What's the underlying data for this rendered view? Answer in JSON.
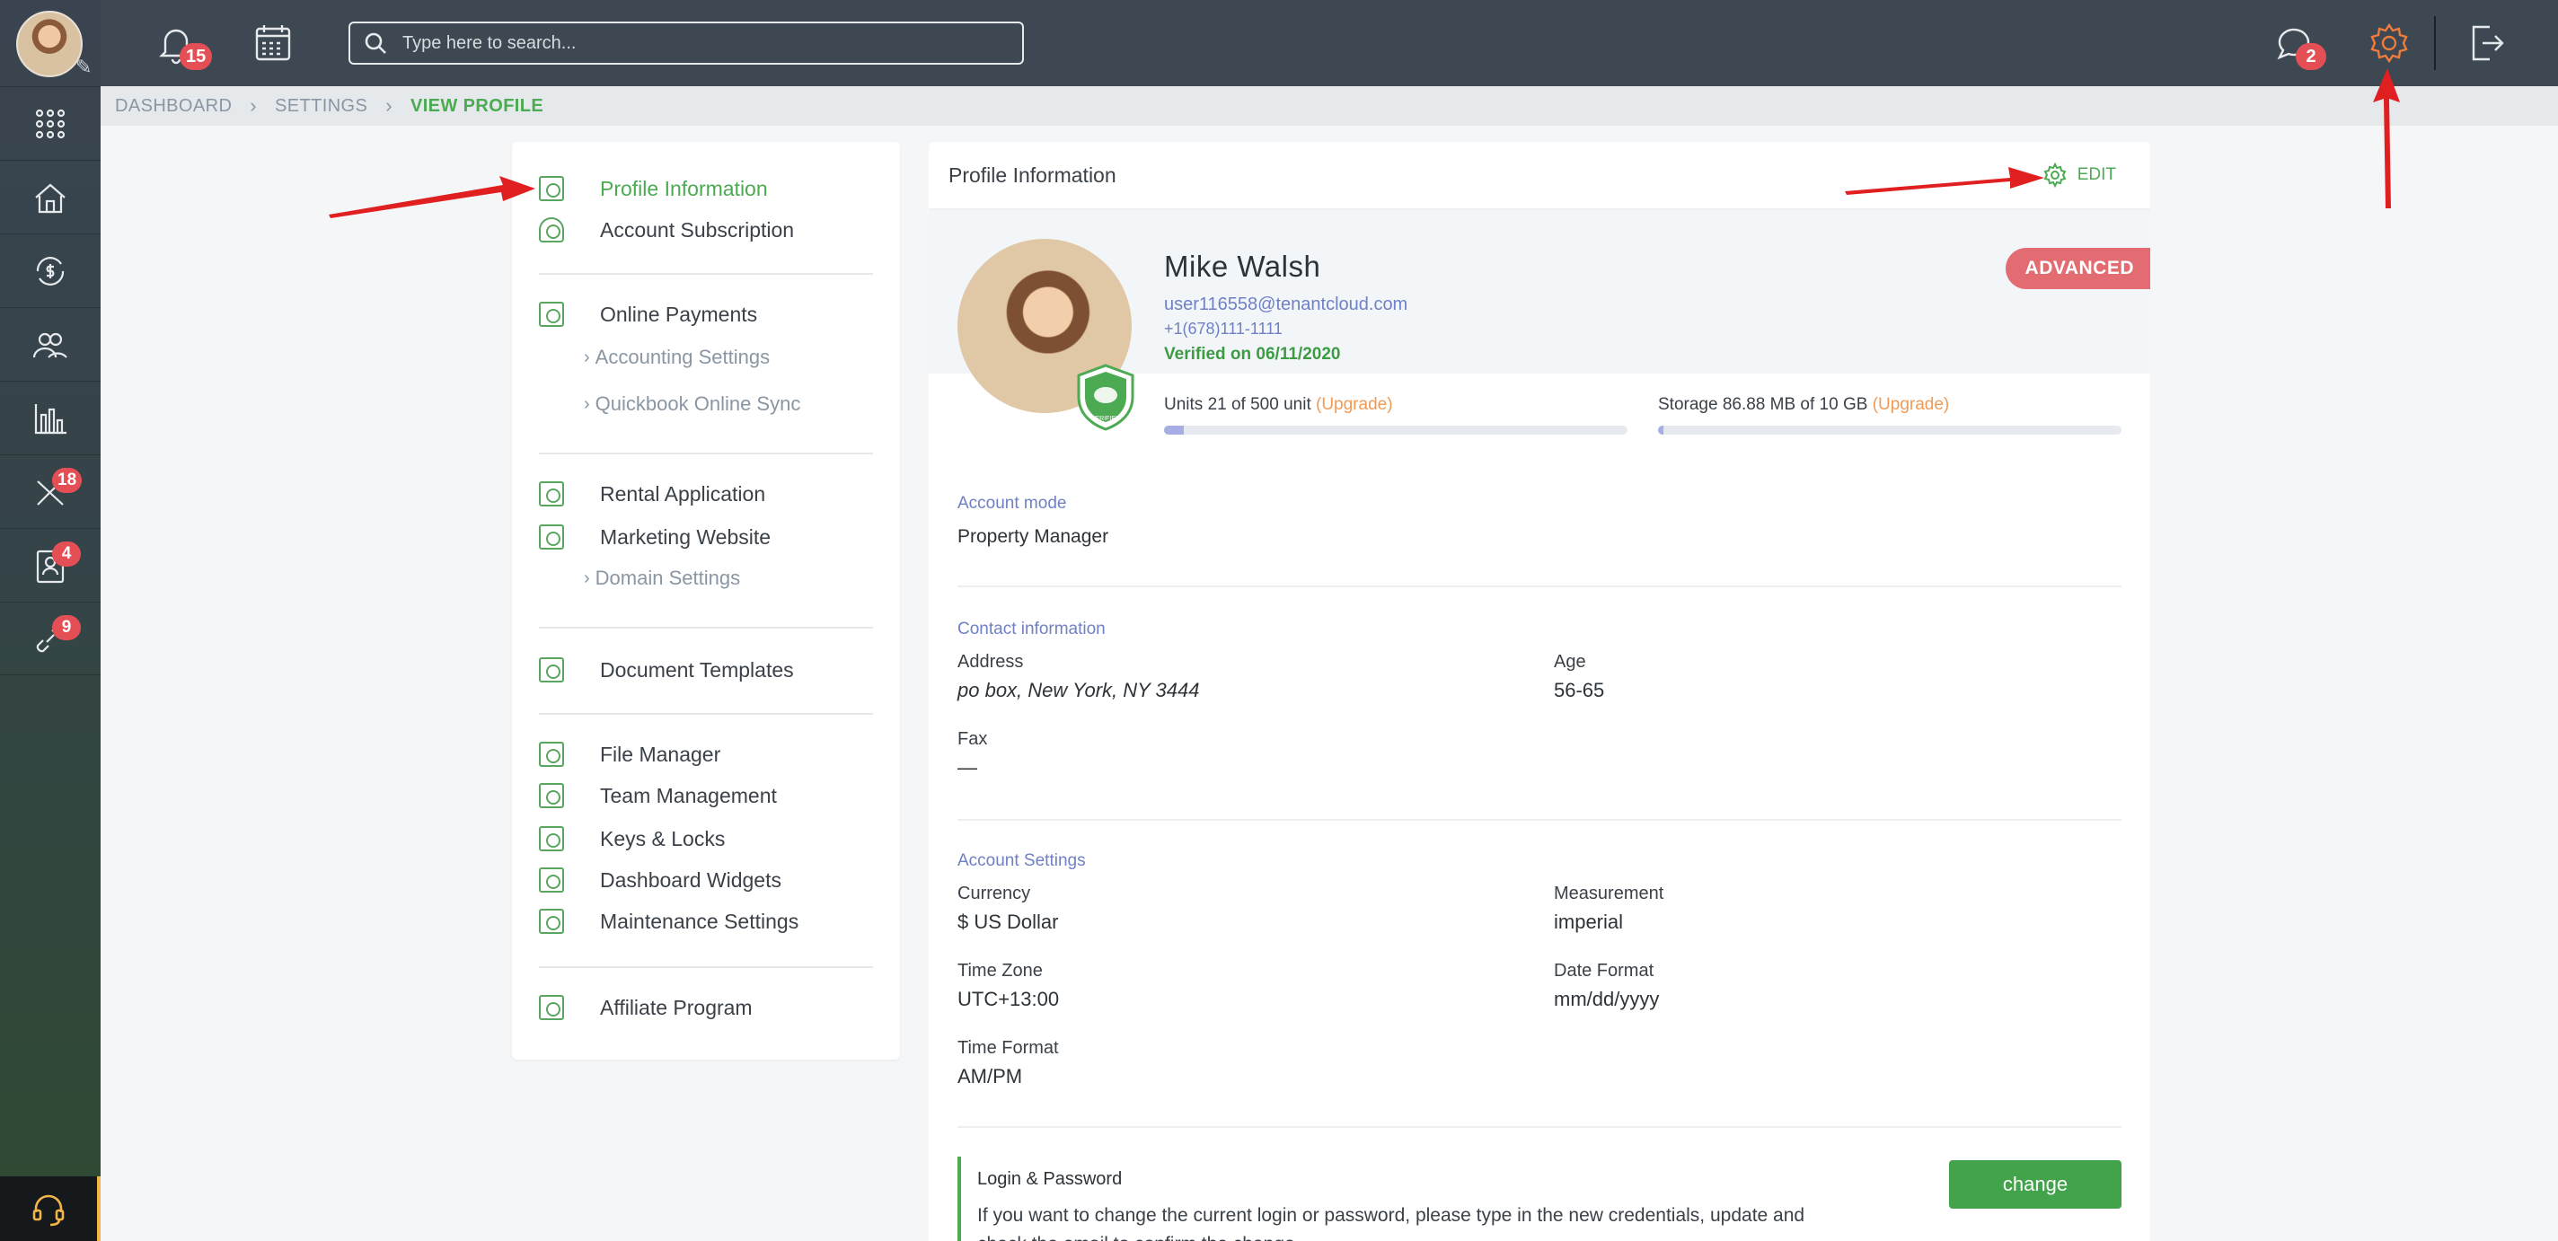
{
  "sidebar": {
    "badges": {
      "tools": "18",
      "contacts": "4",
      "links": "9"
    }
  },
  "topbar": {
    "notifications_count": "15",
    "messages_count": "2",
    "search_placeholder": "Type here to search..."
  },
  "breadcrumb": {
    "items": [
      "DASHBOARD",
      "SETTINGS"
    ],
    "current": "VIEW PROFILE"
  },
  "menu": {
    "profile_information": "Profile Information",
    "account_subscription": "Account Subscription",
    "online_payments": "Online Payments",
    "accounting_settings": "Accounting Settings",
    "quickbook_sync": "Quickbook Online Sync",
    "rental_application": "Rental Application",
    "marketing_website": "Marketing Website",
    "domain_settings": "Domain Settings",
    "document_templates": "Document Templates",
    "file_manager": "File Manager",
    "team_management": "Team Management",
    "keys_locks": "Keys & Locks",
    "dashboard_widgets": "Dashboard Widgets",
    "maintenance_settings": "Maintenance Settings",
    "affiliate_program": "Affiliate Program"
  },
  "profile": {
    "card_title": "Profile Information",
    "edit_label": "EDIT",
    "name": "Mike Walsh",
    "email": "user116558@tenantcloud.com",
    "phone": "+1(678)111-1111",
    "verified": "Verified on 06/11/2020",
    "plan_badge": "ADVANCED",
    "shield_label": "VERIFIED",
    "units": {
      "text": "Units 21 of 500 unit",
      "upgrade": "(Upgrade)",
      "fill_fraction": 0.042
    },
    "storage": {
      "text": "Storage 86.88 MB of 10 GB",
      "upgrade": "(Upgrade)",
      "fill_fraction": 0.009
    },
    "account_mode": {
      "section": "Account mode",
      "value": "Property Manager"
    },
    "contact": {
      "section": "Contact information",
      "address_label": "Address",
      "address_value": "po box, New York, NY 3444",
      "age_label": "Age",
      "age_value": "56-65",
      "fax_label": "Fax",
      "fax_value": "—"
    },
    "account_settings": {
      "section": "Account Settings",
      "currency_label": "Currency",
      "currency_value": "$ US Dollar",
      "measurement_label": "Measurement",
      "measurement_value": "imperial",
      "timezone_label": "Time Zone",
      "timezone_value": "UTC+13:00",
      "dateformat_label": "Date Format",
      "dateformat_value": "mm/dd/yyyy",
      "timeformat_label": "Time Format",
      "timeformat_value": "AM/PM"
    },
    "login": {
      "title": "Login & Password",
      "text": "If you want to change the current login or password, please type in the new credentials, update and check the email to confirm the change.",
      "button": "change"
    }
  },
  "colors": {
    "accent": "#4caa52",
    "badge": "#e44f56",
    "plan": "#e36c73",
    "link": "#6f80c4",
    "upgrade": "#f29a54"
  }
}
